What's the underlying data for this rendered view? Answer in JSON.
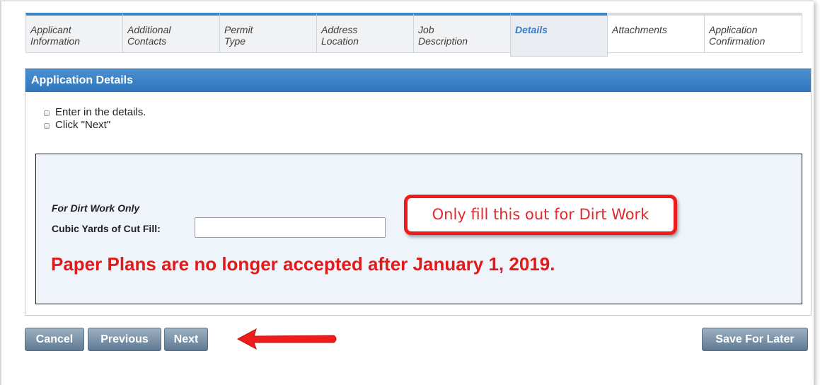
{
  "tabs": [
    {
      "label": "Applicant\nInformation",
      "state": "done"
    },
    {
      "label": "Additional\nContacts",
      "state": "done"
    },
    {
      "label": "Permit\nType",
      "state": "done"
    },
    {
      "label": "Address\nLocation",
      "state": "done"
    },
    {
      "label": "Job\nDescription",
      "state": "done"
    },
    {
      "label": "Details",
      "state": "active"
    },
    {
      "label": "Attachments",
      "state": "pending"
    },
    {
      "label": "Application\nConfirmation",
      "state": "pending"
    }
  ],
  "panel": {
    "title": "Application Details",
    "instructions": [
      "Enter in the details.",
      "Click \"Next\""
    ]
  },
  "form": {
    "section_label": "For Dirt Work Only",
    "cubic_yards_label": "Cubic Yards of Cut Fill:",
    "cubic_yards_value": ""
  },
  "callout": {
    "text": "Only fill this out for Dirt Work"
  },
  "notice": {
    "text": "Paper Plans are no longer accepted after January 1, 2019."
  },
  "buttons": {
    "cancel": "Cancel",
    "previous": "Previous",
    "next": "Next",
    "save_for_later": "Save For Later"
  },
  "colors": {
    "accent_blue": "#3f86c7",
    "header_blue": "#2f76bd",
    "annotation_red": "#ee1c1c",
    "notice_red": "#e21a1a",
    "button_slate": "#6f889f"
  }
}
